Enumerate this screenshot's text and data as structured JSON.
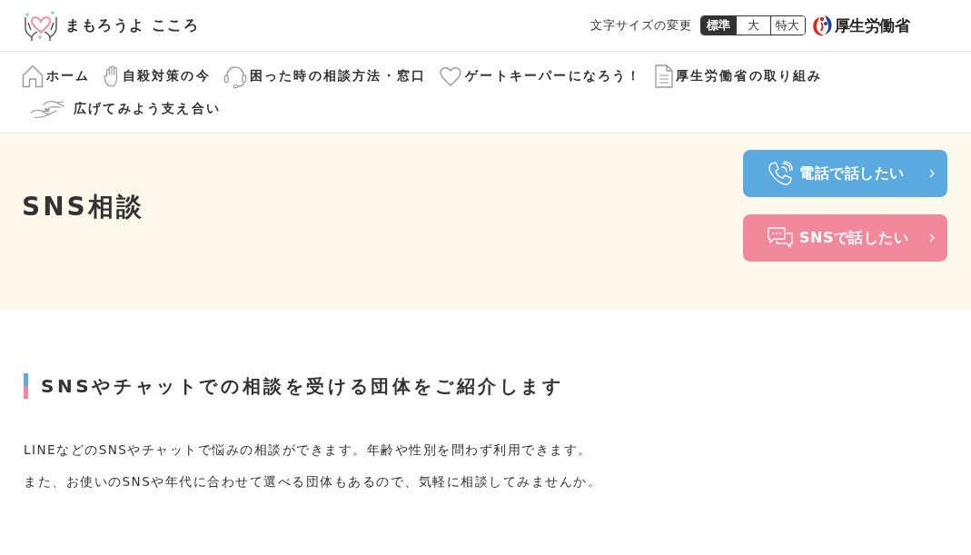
{
  "site": {
    "name": "まもろうよ こころ"
  },
  "font_size": {
    "label": "文字サイズの変更",
    "options": [
      {
        "label": "標準",
        "selected": true
      },
      {
        "label": "大",
        "selected": false
      },
      {
        "label": "特大",
        "selected": false
      }
    ]
  },
  "ministry_logo": {
    "name": "厚生労働省"
  },
  "nav": [
    {
      "label": "ホーム"
    },
    {
      "label": "自殺対策の今"
    },
    {
      "label": "困った時の相談方法・窓口"
    },
    {
      "label": "ゲートキーパーになろう！"
    },
    {
      "label": "厚生労働省の取り組み"
    },
    {
      "label": "広げてみよう支え合い"
    }
  ],
  "hero": {
    "title": "SNS相談",
    "buttons": [
      {
        "label": "電話で話したい",
        "kind": "phone",
        "color": "#5aaae0"
      },
      {
        "label": "SNSで話したい",
        "kind": "chat",
        "color": "#f1889b"
      }
    ]
  },
  "section": {
    "heading": "SNSやチャットでの相談を受ける団体をご紹介します",
    "paragraphs": [
      "LINEなどのSNSやチャットで悩みの相談ができます。年齢や性別を問わず利用できます。",
      "また、お使いのSNSや年代に合わせて選べる団体もあるので、気軽に相談してみませんか。"
    ]
  }
}
